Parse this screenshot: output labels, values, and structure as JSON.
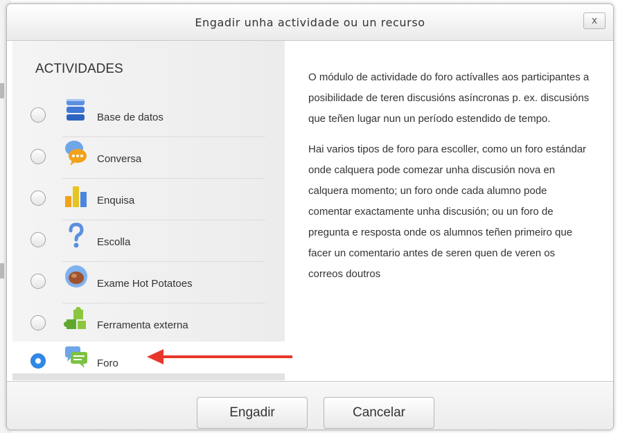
{
  "dialog": {
    "title": "Engadir unha actividade ou un recurso",
    "close_label": "x"
  },
  "activities": {
    "heading": "ACTIVIDADES",
    "items": [
      {
        "label": "Base de datos",
        "icon": "database-icon",
        "selected": false
      },
      {
        "label": "Conversa",
        "icon": "chat-icon",
        "selected": false
      },
      {
        "label": "Enquisa",
        "icon": "survey-chart-icon",
        "selected": false
      },
      {
        "label": "Escolla",
        "icon": "question-mark-icon",
        "selected": false
      },
      {
        "label": "Exame Hot Potatoes",
        "icon": "hot-potatoes-icon",
        "selected": false
      },
      {
        "label": "Ferramenta externa",
        "icon": "puzzle-icon",
        "selected": false
      },
      {
        "label": "Foro",
        "icon": "forum-icon",
        "selected": true
      }
    ]
  },
  "description": {
    "paragraphs": [
      "O módulo de actividade do foro actívalles aos participantes a posibilidade de teren discusións asíncronas p. ex. discusións que teñen lugar nun un período estendido de tempo.",
      "Hai varios tipos de foro para escoller, como un foro estándar onde calquera pode comezar unha discusión nova en calquera momento; un foro onde cada alumno pode comentar exactamente unha discusión; ou un foro de pregunta e resposta onde os alumnos teñen primeiro que facer un comentario antes de seren quen de veren os correos doutros"
    ]
  },
  "footer": {
    "add_label": "Engadir",
    "cancel_label": "Cancelar"
  },
  "colors": {
    "selected_radio": "#2f88e8",
    "arrow": "#e8372a"
  }
}
